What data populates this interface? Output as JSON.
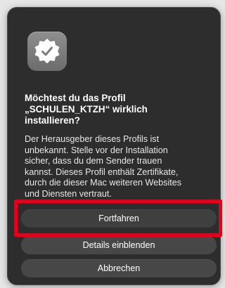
{
  "dialog": {
    "icon": "profile-seal-checkmark-icon",
    "title_lines": [
      "Möchtest du das Profil",
      "„SCHULEN_KTZH“ wirklich",
      "installieren?"
    ],
    "message_lines": [
      "Der Herausgeber dieses Profils ist",
      "unbekannt. Stelle vor der Installation",
      "sicher, dass du dem Sender trauen",
      "kannst. Dieses Profil enthält Zertifikate,",
      "durch die dieser Mac weiteren Websites",
      "und Diensten vertraut."
    ],
    "buttons": {
      "continue": "Fortfahren",
      "details": "Details einblenden",
      "cancel": "Abbrechen"
    }
  },
  "colors": {
    "dialog_background": "#2d2d2d",
    "button_background": "#474747",
    "highlight": "#e2001a",
    "text": "#ffffff"
  }
}
